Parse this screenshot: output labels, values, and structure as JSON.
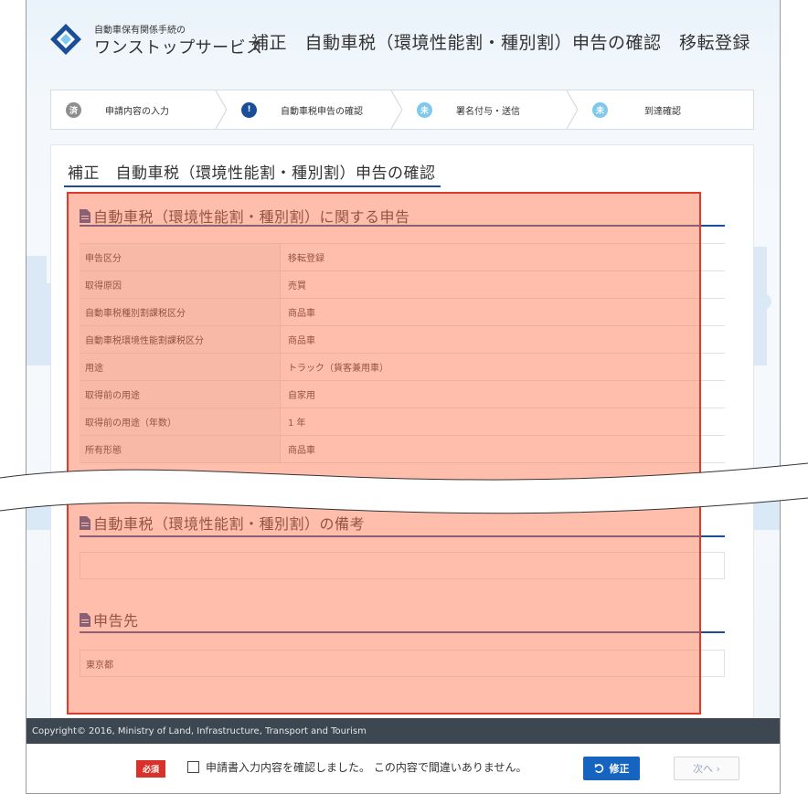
{
  "header": {
    "logo_small": "自動車保有関係手続の",
    "logo_big": "ワンストップサービス",
    "title": "補正　自動車税（環境性能割・種別割）申告の確認　移転登録"
  },
  "steps": [
    {
      "badge": "済",
      "label": "申請内容の入力",
      "state": "done"
    },
    {
      "badge": "!",
      "label": "自動車税申告の確認",
      "state": "current"
    },
    {
      "badge": "未",
      "label": "署名付与・送信",
      "state": "future"
    },
    {
      "badge": "未",
      "label": "到達確認",
      "state": "future"
    }
  ],
  "card": {
    "title": "補正　自動車税（環境性能割・種別割）申告の確認"
  },
  "sections": {
    "declaration_title": "自動車税（環境性能割・種別割）に関する申告",
    "remarks_title": "自動車税（環境性能割・種別割）の備考",
    "destination_title": "申告先"
  },
  "rows": [
    {
      "label": "申告区分",
      "value": "移転登録"
    },
    {
      "label": "取得原因",
      "value": "売買"
    },
    {
      "label": "自動車税種別割課税区分",
      "value": "商品車"
    },
    {
      "label": "自動車税環境性能割課税区分",
      "value": "商品車"
    },
    {
      "label": "用途",
      "value": "トラック（貨客兼用車）"
    },
    {
      "label": "取得前の用途",
      "value": "自家用"
    },
    {
      "label": "取得前の用途（年数）",
      "value": "1 年"
    },
    {
      "label": "所有形態",
      "value": "商品車"
    }
  ],
  "destination_value": "東京都",
  "footer": {
    "copyright": "Copyright© 2016, Ministry of Land, Infrastructure, Transport and Tourism",
    "required": "必須",
    "confirm_text": "申請書入力内容を確認しました。 この内容で間違いありません。",
    "fix_button": "修正",
    "next_button": "次へ ›"
  },
  "colors": {
    "accent": "#1b4e98",
    "highlight": "#e23a2a",
    "fix_button": "#1565c0",
    "footer_bg": "#3d4752"
  }
}
